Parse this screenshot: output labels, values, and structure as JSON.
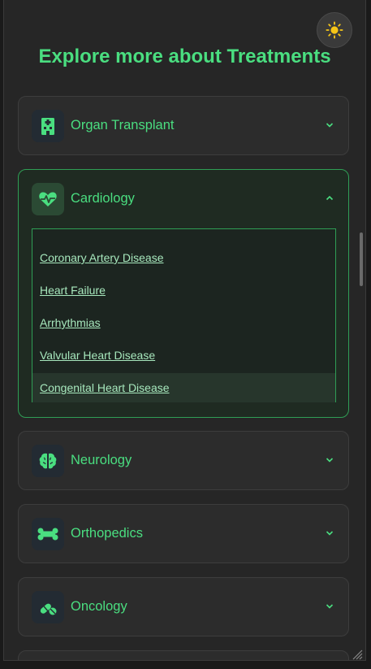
{
  "page": {
    "title": "Explore more about Treatments"
  },
  "theme_toggle": {
    "icon": "sun-icon",
    "color": "#f5c518"
  },
  "treatments": [
    {
      "label": "Organ Transplant",
      "icon": "hospital-icon",
      "expanded": false
    },
    {
      "label": "Cardiology",
      "icon": "heart-pulse-icon",
      "expanded": true,
      "items": [
        "Coronary Artery Disease",
        "Heart Failure",
        "Arrhythmias",
        "Valvular Heart Disease",
        "Congenital Heart Disease"
      ]
    },
    {
      "label": "Neurology",
      "icon": "brain-icon",
      "expanded": false
    },
    {
      "label": "Orthopedics",
      "icon": "bone-icon",
      "expanded": false
    },
    {
      "label": "Oncology",
      "icon": "pills-icon",
      "expanded": false
    }
  ],
  "colors": {
    "accent": "#4ade80",
    "border_open": "#2f9e55",
    "link": "#a7e8bd"
  }
}
